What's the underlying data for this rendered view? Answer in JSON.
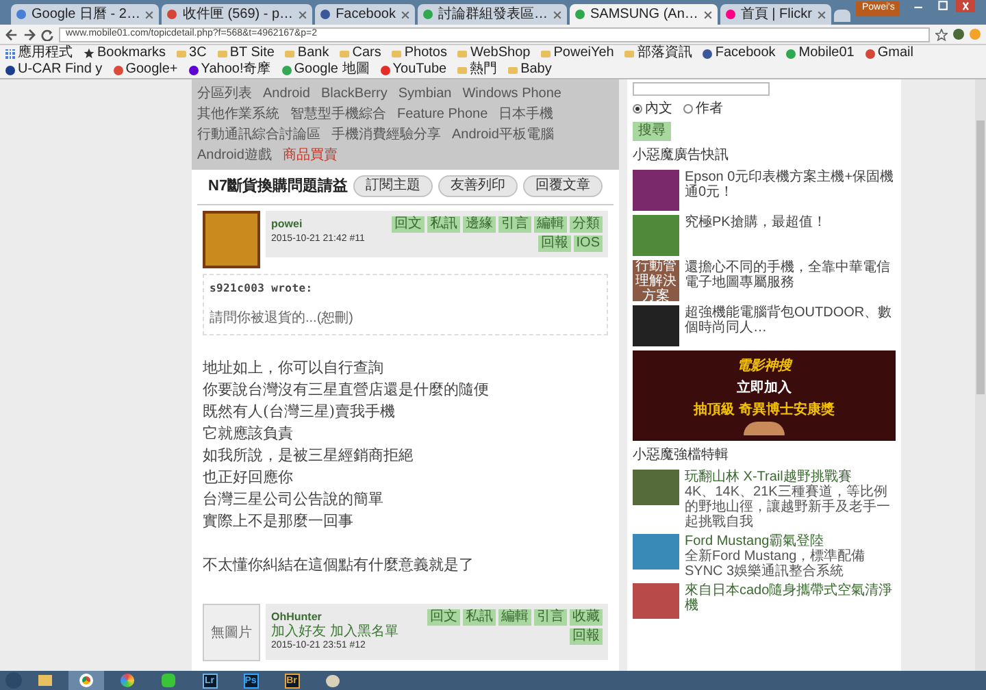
{
  "browser": {
    "tabs": [
      {
        "title": "Google 日曆 - 2…",
        "selected": false,
        "color": "#4a7fd8"
      },
      {
        "title": "收件匣 (569) - p…",
        "selected": false,
        "color": "#d44638"
      },
      {
        "title": "Facebook",
        "selected": false,
        "color": "#3b5998"
      },
      {
        "title": "討論群組發表區…",
        "selected": false,
        "color": "#2fa84f"
      },
      {
        "title": "SAMSUNG (An…",
        "selected": true,
        "color": "#2fa84f"
      },
      {
        "title": "首頁 | Flickr",
        "selected": false,
        "color": "#ff0084"
      }
    ],
    "profile": "Powei's",
    "url": "www.mobile01.com/topicdetail.php?f=568&t=4962167&p=2",
    "bookmarks": [
      {
        "label": "應用程式",
        "kind": "apps"
      },
      {
        "label": "Bookmarks",
        "kind": "star"
      },
      {
        "label": "3C",
        "kind": "folder"
      },
      {
        "label": "BT Site",
        "kind": "folder"
      },
      {
        "label": "Bank",
        "kind": "folder"
      },
      {
        "label": "Cars",
        "kind": "folder"
      },
      {
        "label": "Photos",
        "kind": "folder"
      },
      {
        "label": "WebShop",
        "kind": "folder"
      },
      {
        "label": "PoweiYeh",
        "kind": "folder"
      },
      {
        "label": "部落資訊",
        "kind": "folder"
      },
      {
        "label": "Facebook",
        "kind": "site",
        "color": "#3b5998"
      },
      {
        "label": "Mobile01",
        "kind": "site",
        "color": "#2fa84f"
      },
      {
        "label": "Gmail",
        "kind": "site",
        "color": "#d44638"
      },
      {
        "label": "U-CAR Find y",
        "kind": "site",
        "color": "#1d3d8f"
      },
      {
        "label": "Google+",
        "kind": "site",
        "color": "#dd4b39"
      },
      {
        "label": "Yahoo!奇摩",
        "kind": "site",
        "color": "#5f01d1"
      },
      {
        "label": "Google 地圖",
        "kind": "site",
        "color": "#34a853"
      },
      {
        "label": "YouTube",
        "kind": "site",
        "color": "#e52d27"
      },
      {
        "label": "熱門",
        "kind": "folder"
      },
      {
        "label": "Baby",
        "kind": "folder"
      }
    ]
  },
  "forum_nav": {
    "items": [
      "分區列表",
      "Android",
      "BlackBerry",
      "Symbian",
      "Windows Phone",
      "其他作業系統",
      "智慧型手機綜合",
      "Feature Phone",
      "日本手機",
      "行動通訊綜合討論區",
      "手機消費經驗分享",
      "Android平板電腦",
      "Android遊戲"
    ],
    "sale_link": "商品買賣"
  },
  "topic": {
    "title": "N7斷貨換購問題請益",
    "actions": [
      "訂閱主題",
      "友善列印",
      "回覆文章"
    ]
  },
  "posts": [
    {
      "author": "powei",
      "has_photo": true,
      "meta": "2015-10-21 21:42 #11",
      "actions": [
        "回文",
        "私訊",
        "邊緣",
        "引言",
        "編輯",
        "分類",
        "回報",
        "IOS"
      ],
      "quote": {
        "author": "s921c003 wrote:",
        "text": "請問你被退貨的...(恕刪)"
      },
      "body": [
        "地址如上，你可以自行查詢",
        "你要說台灣沒有三星直營店還是什麼的隨便",
        "既然有人(台灣三星)賣我手機",
        "它就應該負責",
        "如我所說，是被三星經銷商拒絕",
        "也正好回應你",
        "台灣三星公司公告說的簡單",
        "實際上不是那麼一回事"
      ],
      "closing": "不太懂你糾結在這個點有什麼意義就是了"
    },
    {
      "author": "OhHunter",
      "has_photo": false,
      "avatar_text": "無圖片",
      "links": "加入好友  加入黑名單",
      "meta": "2015-10-21 23:51 #12",
      "actions": [
        "回文",
        "私訊",
        "編輯",
        "引言",
        "收藏",
        "回報"
      ]
    }
  ],
  "sidebar": {
    "search": {
      "options": [
        {
          "label": "內文",
          "selected": true
        },
        {
          "label": "作者",
          "selected": false
        }
      ],
      "button": "搜尋"
    },
    "ads_title": "小惡魔廣告快訊",
    "ads": [
      {
        "text": "Epson 0元印表機方案主機+保固機通0元！",
        "color": "#7a2a6a"
      },
      {
        "text": "究極PK搶購，最超值！",
        "color": "#4f8a3a"
      },
      {
        "text": "還擔心不同的手機，全靠中華電信電子地圖專屬服務",
        "color": "#8a5a44",
        "image_text": "行動管理解決方案"
      },
      {
        "text": "超強機能電腦背包OUTDOOR、數個時尚同人…",
        "color": "#222222"
      }
    ],
    "banner": {
      "brand": "電影神搜",
      "line1": "立即加入",
      "line2": "抽頂級 奇異博士安康獎"
    },
    "features_title": "小惡魔強檔特輯",
    "features": [
      {
        "title": "玩翻山林 X-Trail越野挑戰賽",
        "text": "4K、14K、21K三種賽道，等比例的野地山徑，讓越野新手及老手一起挑戰自我",
        "color": "#556b3a"
      },
      {
        "title": "Ford Mustang霸氣登陸",
        "text": "全新Ford Mustang，標準配備SYNC 3娛樂通訊整合系統",
        "color": "#3a8ab8"
      },
      {
        "title": "來自日本cado隨身攜帶式空氣清淨機",
        "color": "#b84a4a"
      }
    ]
  },
  "taskbar": {
    "apps": [
      {
        "kind": "explorer"
      },
      {
        "kind": "chrome",
        "selected": true
      },
      {
        "kind": "photos"
      },
      {
        "kind": "line"
      },
      {
        "kind": "logo",
        "label": "Lr",
        "color": "#6fb3e8"
      },
      {
        "kind": "logo",
        "label": "Ps",
        "color": "#31a8ff"
      },
      {
        "kind": "logo",
        "label": "Br",
        "color": "#e8a33a"
      },
      {
        "kind": "paint"
      }
    ]
  }
}
